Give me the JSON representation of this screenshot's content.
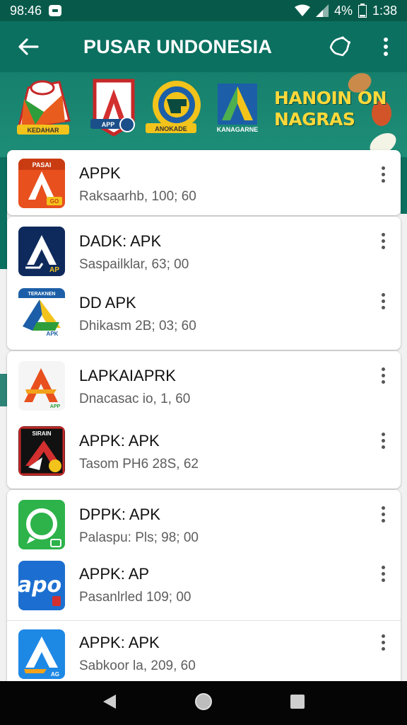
{
  "status_bar": {
    "time_left": "98:46",
    "battery_percent": "4%",
    "time_right": "1:38"
  },
  "app_bar": {
    "title": "PUSAR UNDONESIA",
    "back_icon": "arrow-left-icon",
    "share_icon": "share-icon",
    "overflow_icon": "more-vert-icon"
  },
  "banner": {
    "logos": [
      {
        "name": "banner-logo-1",
        "caption": "KEDAHAR"
      },
      {
        "name": "banner-logo-2",
        "caption": "APP"
      },
      {
        "name": "banner-logo-3",
        "caption": "ANOKADE"
      },
      {
        "name": "banner-logo-4",
        "caption": "KANAGARNE"
      }
    ],
    "promo_line1": "HANOIN ON",
    "promo_line2": "NAGRAS"
  },
  "apps": [
    {
      "name": "APPK",
      "sub": "Raksaarhb, 100; 60",
      "icon_label": "PASAI",
      "icon_badge": "GO"
    },
    {
      "name": "DADK: APK",
      "sub": "Saspailklar, 63; 00",
      "icon_badge": "AP"
    },
    {
      "name": "DD APK",
      "sub": "Dhikasm 2B; 03; 60",
      "icon_label": "TERAKNEN",
      "icon_badge": "APK"
    },
    {
      "name": "LAPKAIAPRK",
      "sub": "Dnacasac io, 1, 60",
      "icon_badge": "APP"
    },
    {
      "name": "APPK: APK",
      "sub": "Tasom PH6 28S, 62",
      "icon_label": "SIRAIN"
    },
    {
      "name": "DPPK: APK",
      "sub": "Palaspu: Pls; 98; 00"
    },
    {
      "name": "APPK: AP",
      "sub": "Pasanlrled 109; 00",
      "icon_label": "apo"
    },
    {
      "name": "APPK: APK",
      "sub": "Sabkoor la, 209, 60",
      "icon_badge": "AG"
    }
  ],
  "colors": {
    "primary": "#0b7060",
    "primary_dark": "#075a4a",
    "banner": "#1e8e78",
    "accent": "#ffd93a"
  },
  "nav": {
    "back_icon": "nav-back-icon",
    "home_icon": "nav-home-icon",
    "recents_icon": "nav-recents-icon"
  }
}
